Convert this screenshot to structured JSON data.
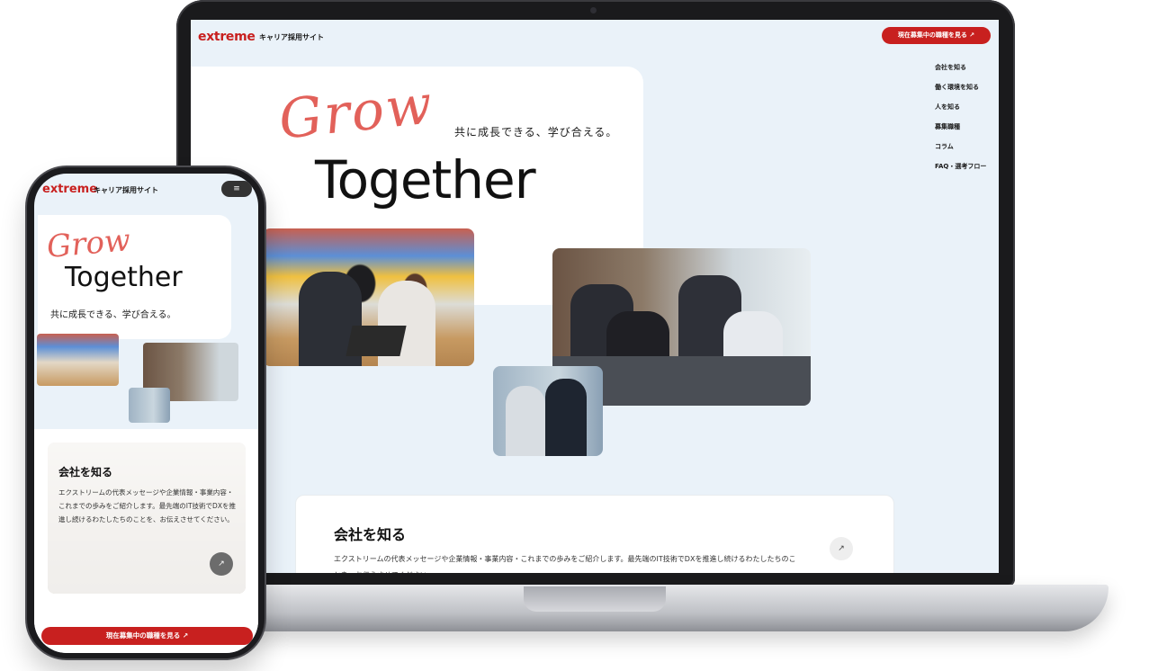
{
  "desktop": {
    "header": {
      "logo": "extreme",
      "site_name": "キャリア採用サイト",
      "cta": "現在募集中の職種を見る ↗"
    },
    "nav": {
      "items": [
        {
          "label": "会社を知る"
        },
        {
          "label": "働く環境を知る"
        },
        {
          "label": "人を知る"
        },
        {
          "label": "募集職種"
        },
        {
          "label": "コラム"
        },
        {
          "label": "FAQ・選考フロー"
        }
      ]
    },
    "hero": {
      "grow": "Grow",
      "together": "Together",
      "tagline": "共に成長できる、学び合える。"
    },
    "info_card": {
      "title": "会社を知る",
      "description": "エクストリームの代表メッセージや企業情報・事業内容・これまでの歩みをご紹介します。最先端のIT技術でDXを推進し続けるわたしたちのことを、お伝えさせてください。",
      "arrow": "↗"
    }
  },
  "mobile": {
    "header": {
      "logo": "extreme",
      "site_name": "キャリア採用サイト",
      "menu_icon": "≡"
    },
    "hero": {
      "grow": "Grow",
      "together": "Together",
      "tagline": "共に成長できる、学び合える。"
    },
    "info_card": {
      "title": "会社を知る",
      "description": "エクストリームの代表メッセージや企業情報・事業内容・これまでの歩みをご紹介します。最先端のIT技術でDXを推進し続けるわたしたちのことを、お伝えさせてください。",
      "arrow": "↗"
    },
    "cta": "現在募集中の職種を見る ↗"
  },
  "colors": {
    "brand_red": "#c8201f",
    "grow_coral": "#e2615a",
    "page_bg": "#eaf2f9"
  }
}
